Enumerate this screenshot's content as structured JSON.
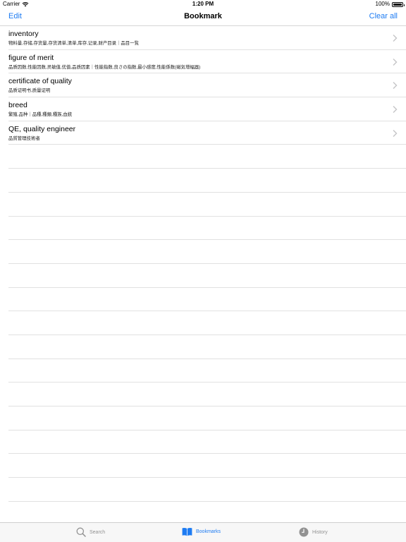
{
  "status_bar": {
    "carrier": "Carrier",
    "time": "1:20 PM",
    "battery": "100%"
  },
  "nav": {
    "edit_label": "Edit",
    "title": "Bookmark",
    "clear_label": "Clear all"
  },
  "bookmarks": [
    {
      "term": "inventory",
      "translations": "物料量,存储,存货量,存货清单,清单,库存,记录,财产目录｜品目一覧"
    },
    {
      "term": "figure of merit",
      "translations": "品质因数,性能因数,灵敏值,优值,品质因素｜性能指数,良さの指数,最小感度,性能係数(磁気增幅器)"
    },
    {
      "term": "certificate of quality",
      "translations": "品质证明书,质量证明"
    },
    {
      "term": "breed",
      "translations": "繁殖,品种｜品種,種類,種族,血統"
    },
    {
      "term": "QE, quality engineer",
      "translations": "品質管理技術者"
    }
  ],
  "tabs": {
    "search_label": "Search",
    "bookmarks_label": "Bookmarks",
    "history_label": "History"
  },
  "colors": {
    "accent": "#1e7cf2",
    "inactive": "#929292"
  },
  "icons": {
    "wifi": "wifi-icon",
    "chevron": "chevron-right-icon",
    "search": "search-icon",
    "bookmarks": "book-icon",
    "history": "clock-icon"
  }
}
